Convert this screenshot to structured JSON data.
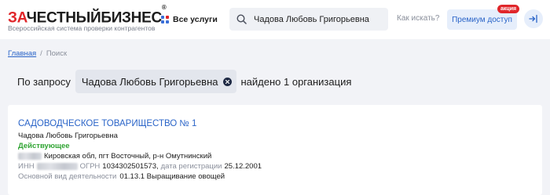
{
  "header": {
    "logo_red": "ЗА",
    "logo_dark": "ЧЕСТНЫЙБИЗНЕС",
    "logo_mark": "®",
    "logo_subtitle": "Всероссийская система проверки контрагентов",
    "services_label": "Все услуги",
    "search_value": "Чадова Любовь Григорьевна",
    "how_to_search": "Как искать?",
    "premium_label": "Премиум доступ",
    "promo_badge": "акция"
  },
  "breadcrumb": {
    "home": "Главная",
    "separator": "/",
    "current": "Поиск"
  },
  "query": {
    "prefix": "По запросу",
    "term": "Чадова Любовь Григорьевна",
    "suffix": "найдено 1 организация"
  },
  "result": {
    "title": "САДОВОДЧЕСКОЕ ТОВАРИЩЕСТВО № 1",
    "person": "Чадова Любовь Григорьевна",
    "status": "Действующее",
    "status_color": "#2fa432",
    "address": "Кировская обл, пгт Восточный, р-н Омутнинский",
    "inn_label": "ИНН",
    "ogrn_label": "ОГРН",
    "ogrn_value": "1034302501573,",
    "reg_label": "дата регистрации",
    "reg_date": "25.12.2001",
    "activity_label": "Основной вид деятельности",
    "activity_value": "01.13.1 Выращивание овощей"
  },
  "colors": {
    "brand_red": "#e0262a",
    "link_blue": "#2a64c8",
    "background": "#f2f3f7"
  }
}
